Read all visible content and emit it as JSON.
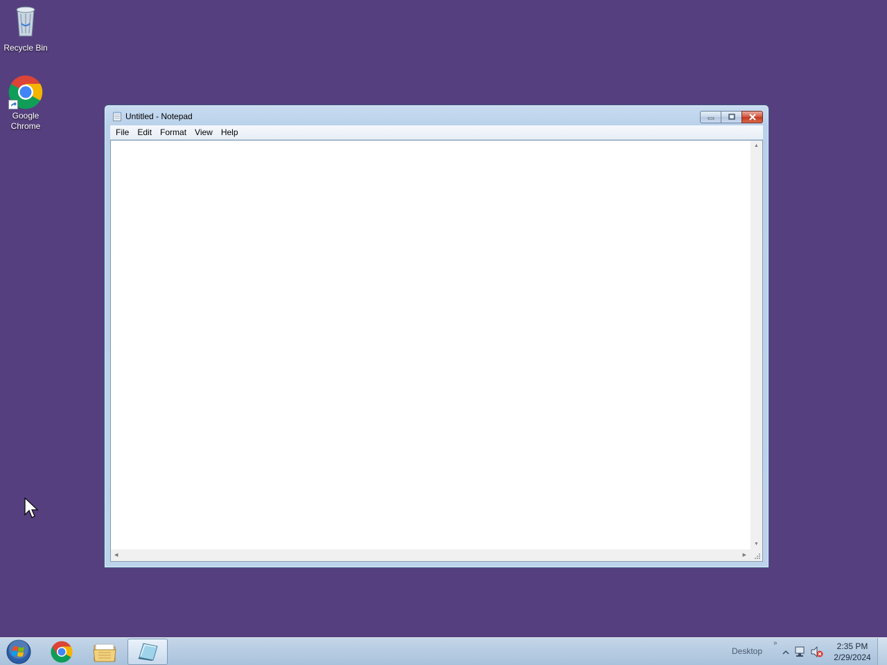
{
  "desktop": {
    "background": "#563f7f",
    "icons": [
      {
        "label": "Recycle Bin",
        "icon": "recycle-bin-icon"
      },
      {
        "label": "Google\nChrome",
        "label_line1": "Google",
        "label_line2": "Chrome",
        "icon": "chrome-icon"
      }
    ]
  },
  "window": {
    "title": "Untitled - Notepad",
    "menu": [
      "File",
      "Edit",
      "Format",
      "View",
      "Help"
    ],
    "content": ""
  },
  "taskbar": {
    "pinned": [
      "start-orb-icon",
      "chrome-icon",
      "file-explorer-icon",
      "notepad-icon"
    ],
    "tray": {
      "desktop_label": "Desktop",
      "time": "2:35 PM",
      "date": "2/29/2024"
    }
  },
  "colors": {
    "close_button": "#c1381f",
    "taskbar": "#b7cbe1"
  }
}
